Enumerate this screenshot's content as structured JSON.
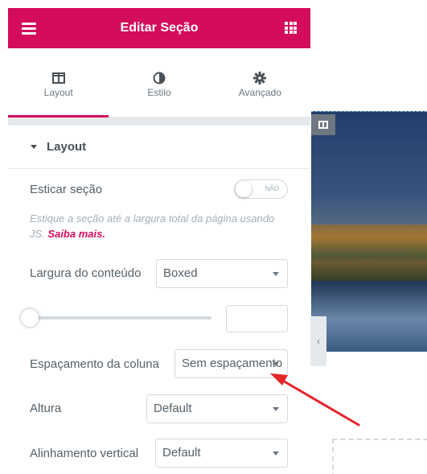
{
  "header": {
    "title": "Editar Seção",
    "menu_icon": "hamburger-icon",
    "apps_icon": "grid-icon"
  },
  "tabs": [
    {
      "label": "Layout",
      "icon": "columns-icon",
      "active": true
    },
    {
      "label": "Estilo",
      "icon": "half-circle-icon",
      "active": false
    },
    {
      "label": "Avançado",
      "icon": "gear-icon",
      "active": false
    }
  ],
  "section": {
    "title": "Layout"
  },
  "controls": {
    "stretch_label": "Esticar seção",
    "stretch_toggle": "NÃO",
    "stretch_desc": "Estique a seção até a largura total da página usando JS.",
    "stretch_link": "Saiba mais.",
    "content_width_label": "Largura do conteúdo",
    "content_width_value": "Boxed",
    "gap_label": "Espaçamento da coluna",
    "gap_value": "Sem espaçamento",
    "height_label": "Altura",
    "height_value": "Default",
    "valign_label": "Alinhamento vertical",
    "valign_value": "Default"
  },
  "colors": {
    "accent": "#d30c5c",
    "annotation_arrow": "#e3262b"
  }
}
